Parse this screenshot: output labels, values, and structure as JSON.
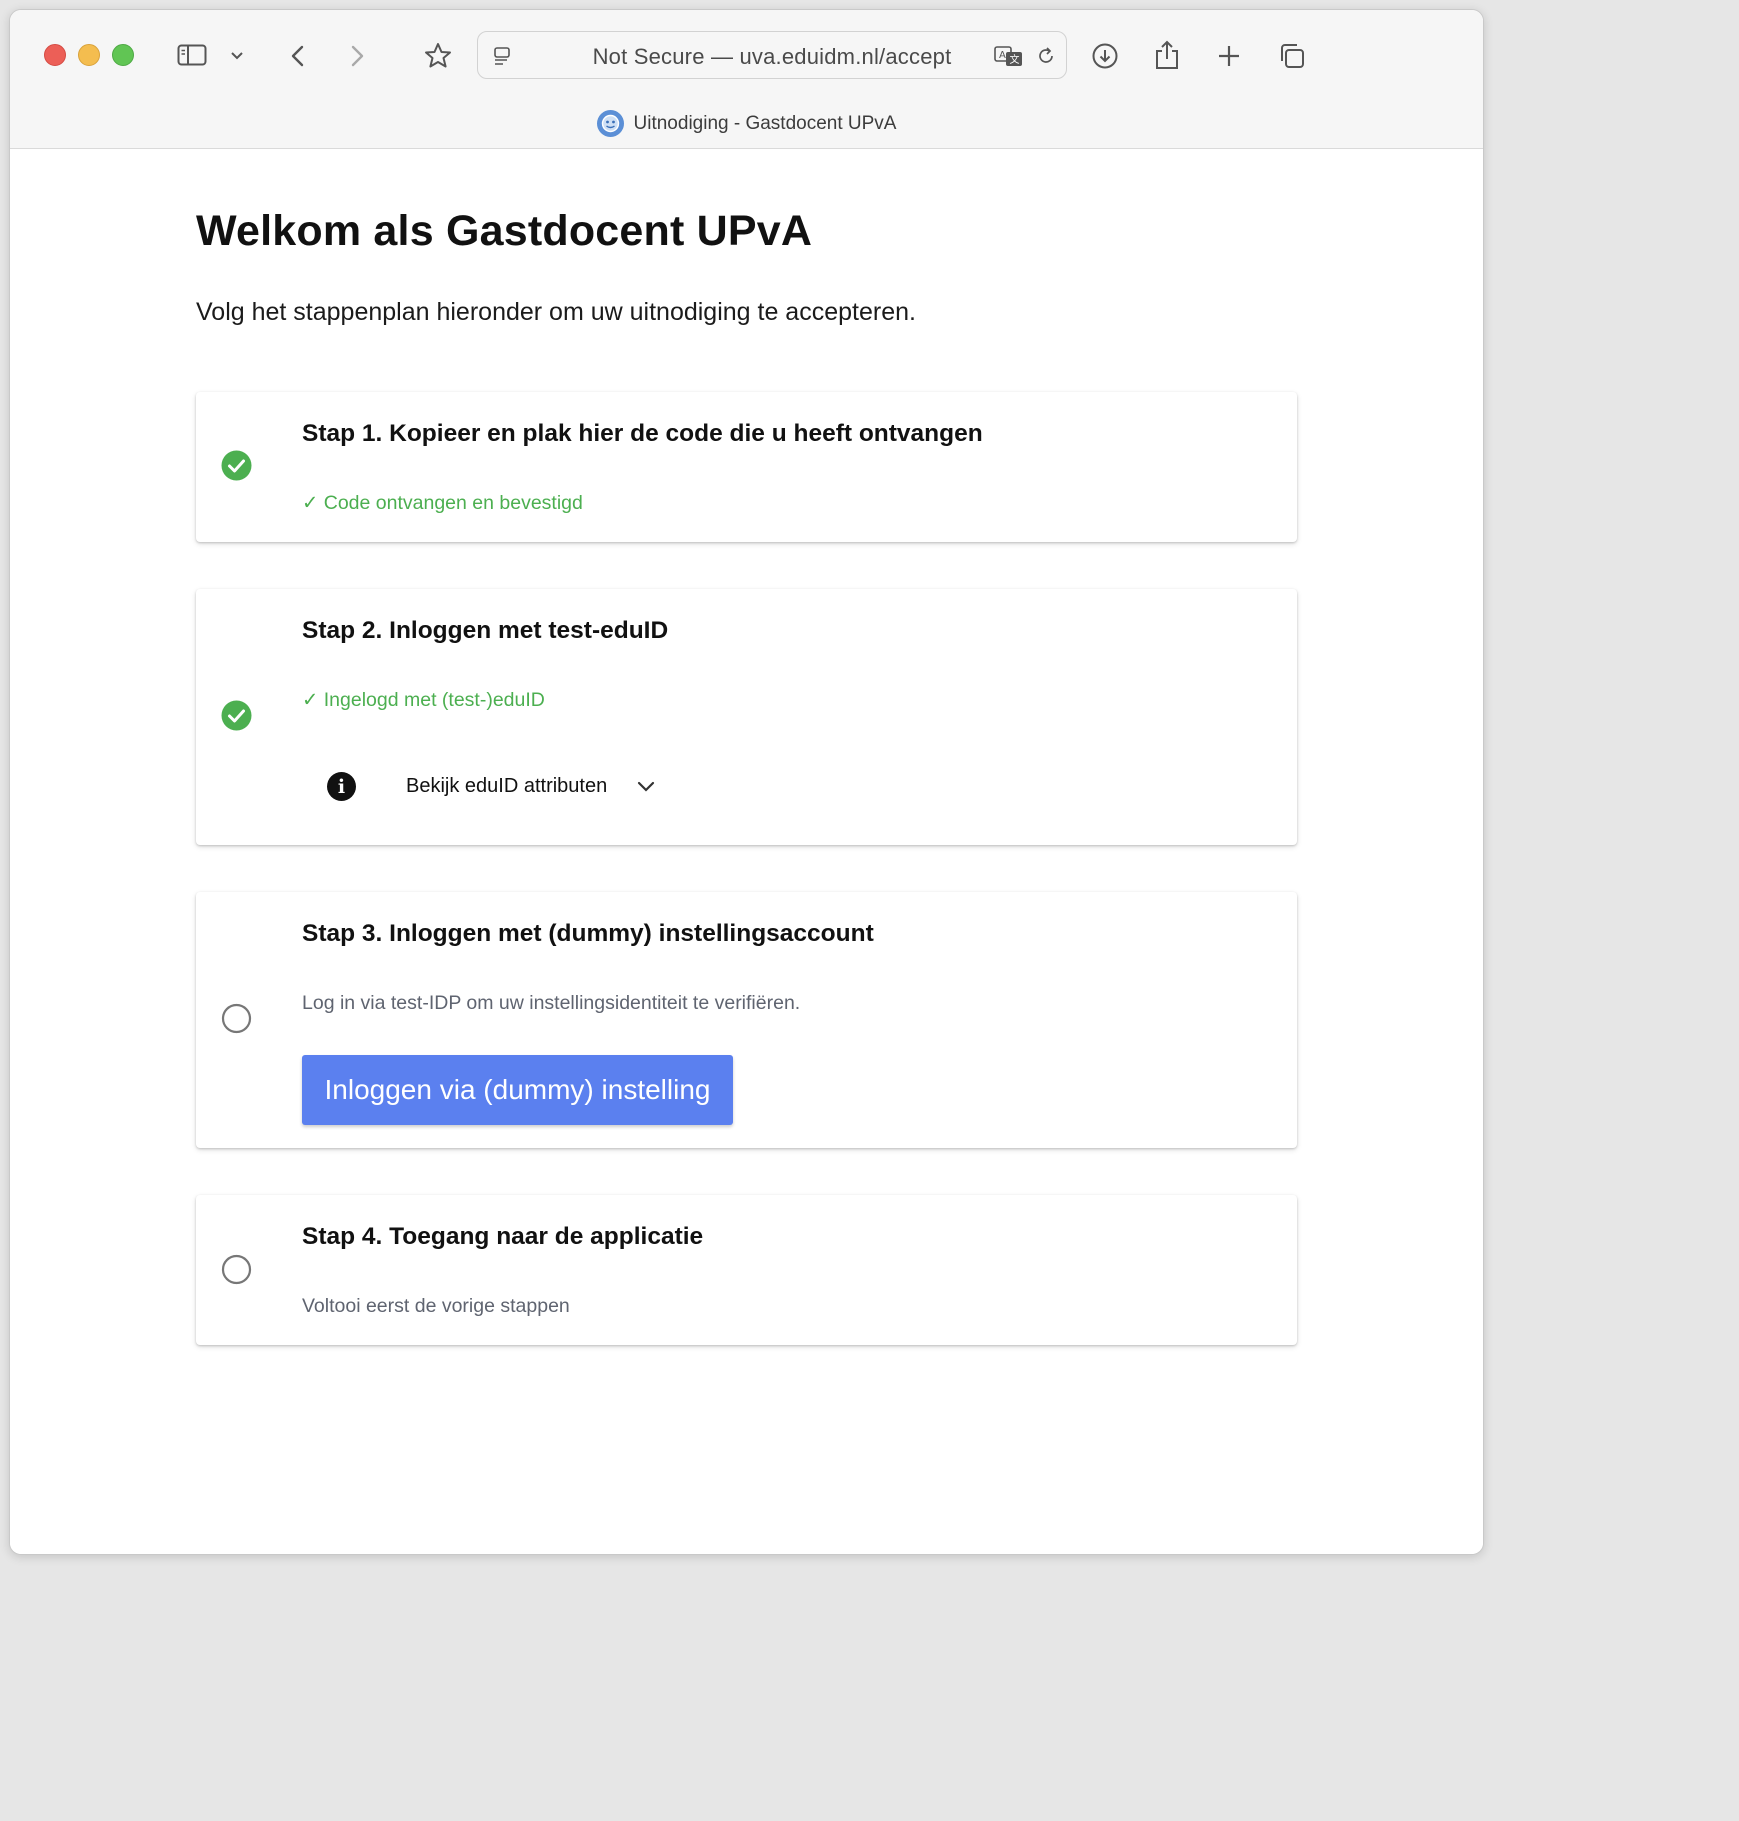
{
  "browser": {
    "address": "Not Secure — uva.eduidm.nl/accept",
    "tab_title": "Uitnodiging - Gastdocent UPvA"
  },
  "page": {
    "title": "Welkom als Gastdocent UPvA",
    "intro": "Volg het stappenplan hieronder om uw uitnodiging te accepteren."
  },
  "steps": [
    {
      "title": "Stap 1. Kopieer en plak hier de code die u heeft ontvangen",
      "status": "completed",
      "message": "✓ Code ontvangen en bevestigd"
    },
    {
      "title": "Stap 2. Inloggen met test-eduID",
      "status": "completed",
      "message": "✓ Ingelogd met (test-)eduID",
      "details_label": "Bekijk eduID attributen"
    },
    {
      "title": "Stap 3. Inloggen met (dummy) instellingsaccount",
      "status": "pending",
      "message": "Log in via test-IDP om uw instellingsidentiteit te verifiëren.",
      "button_label": "Inloggen via (dummy) instelling"
    },
    {
      "title": "Stap 4. Toegang naar de applicatie",
      "status": "pending",
      "message": "Voltooi eerst de vorige stappen"
    }
  ],
  "colors": {
    "success": "#4caf50",
    "primary_button": "#5b80ef",
    "pending_circle": "#777777"
  },
  "icons": {
    "completed": "check-circle-icon",
    "pending": "empty-circle-icon",
    "info": "info-icon",
    "expand": "chevron-down-icon"
  }
}
